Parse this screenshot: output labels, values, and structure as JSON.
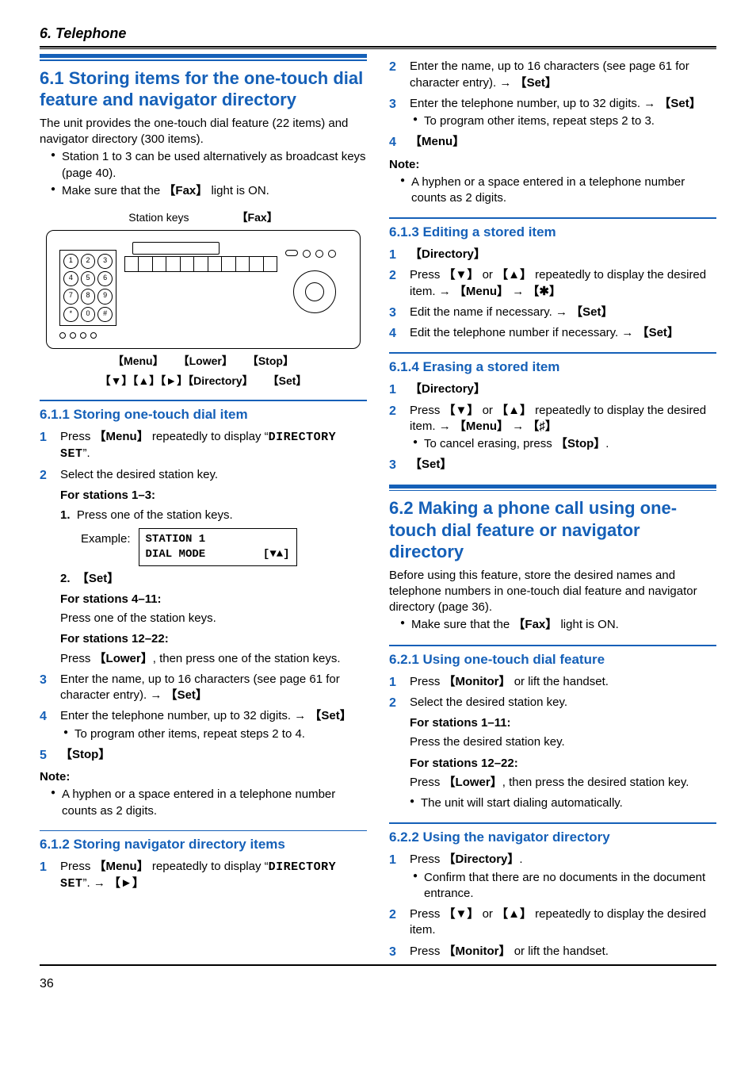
{
  "header": {
    "chapter": "6. Telephone",
    "page_number": "36"
  },
  "figure": {
    "top_labels": {
      "left": "Station keys",
      "right": "【Fax】"
    },
    "bottom_row1": {
      "a": "【Menu】",
      "b": "【Lower】",
      "c": "【Stop】"
    },
    "bottom_row2": {
      "a": "【▼】【▲】【►】【Directory】",
      "b": "【Set】"
    },
    "lcd": {
      "line1": "STATION 1",
      "line2_left": "DIAL MODE",
      "line2_right": "[▼▲]"
    },
    "example_label": "Example:"
  },
  "s61": {
    "title": "6.1 Storing items for the one-touch dial feature and navigator directory",
    "lead": "The unit provides the one-touch dial feature (22 items) and navigator directory (300 items).",
    "b1": "Station 1 to 3 can be used alternatively as broadcast keys (page 40).",
    "b2_pre": "Make sure that the ",
    "b2_btn": "Fax",
    "b2_post": " light is ON."
  },
  "s611": {
    "title": "6.1.1 Storing one-touch dial item",
    "s1_pre": "Press ",
    "s1_btn": "Menu",
    "s1_mid": " repeatedly to display ",
    "s1_q1": "“",
    "s1_mono": "DIRECTORY SET",
    "s1_q2": "”.",
    "s2": "Select the desired station key.",
    "sub13": "For stations 1–3:",
    "sub13_1": "Press one of the station keys.",
    "sub_2_btn": "Set",
    "sub411": "For stations 4–11:",
    "sub411_body": "Press one of the station keys.",
    "sub1222": "For stations 12–22:",
    "sub1222_pre": "Press ",
    "sub1222_btn": "Lower",
    "sub1222_post": ", then press one of the station keys.",
    "s3_pre": "Enter the name, up to 16 characters (see page 61 for character entry). ",
    "s3_btn": "Set",
    "s4_pre": "Enter the telephone number, up to 32 digits. ",
    "s4_btn": "Set",
    "s4_b": "To program other items, repeat steps 2 to 4.",
    "s5_btn": "Stop",
    "note_head": "Note:",
    "note_b": "A hyphen or a space entered in a telephone number counts as 2 digits."
  },
  "s612": {
    "title": "6.1.2 Storing navigator directory items",
    "s1_pre": "Press ",
    "s1_btn": "Menu",
    "s1_mid": " repeatedly to display ",
    "s1_q1": "“",
    "s1_mono": "DIRECTORY SET",
    "s1_q2": "”. ",
    "s1_arrow_btn": "►",
    "s2_pre": "Enter the name, up to 16 characters (see page 61 for character entry). ",
    "s2_btn": "Set",
    "s3_pre": "Enter the telephone number, up to 32 digits. ",
    "s3_btn": "Set",
    "s3_b": "To program other items, repeat steps 2 to 3.",
    "s4_btn": "Menu",
    "note_head": "Note:",
    "note_b": "A hyphen or a space entered in a telephone number counts as 2 digits."
  },
  "s613": {
    "title": "6.1.3 Editing a stored item",
    "s1_btn": "Directory",
    "s2_pre": "Press ",
    "s2_d": "▼",
    "s2_or": " or ",
    "s2_u": "▲",
    "s2_mid": " repeatedly to display the desired item. ",
    "s2_btn1": "Menu",
    "s2_btn2": "✱",
    "s3_pre": "Edit the name if necessary. ",
    "s3_btn": "Set",
    "s4_pre": "Edit the telephone number if necessary. ",
    "s4_btn": "Set"
  },
  "s614": {
    "title": "6.1.4 Erasing a stored item",
    "s1_btn": "Directory",
    "s2_pre": "Press ",
    "s2_d": "▼",
    "s2_or": " or ",
    "s2_u": "▲",
    "s2_mid": " repeatedly to display the desired item. ",
    "s2_btn1": "Menu",
    "s2_btn2": "♯",
    "s2_b_pre": "To cancel erasing, press ",
    "s2_b_btn": "Stop",
    "s3_btn": "Set"
  },
  "s62": {
    "title": "6.2 Making a phone call using one-touch dial feature or navigator directory",
    "lead": "Before using this feature, store the desired names and telephone numbers in one-touch dial feature and navigator directory (page 36).",
    "b1_pre": "Make sure that the ",
    "b1_btn": "Fax",
    "b1_post": " light is ON."
  },
  "s621": {
    "title": "6.2.1 Using one-touch dial feature",
    "s1_pre": "Press ",
    "s1_btn": "Monitor",
    "s1_post": " or lift the handset.",
    "s2": "Select the desired station key.",
    "sub111": "For stations 1–11:",
    "sub111_body": "Press the desired station key.",
    "sub1222": "For stations 12–22:",
    "sub1222_pre": "Press ",
    "sub1222_btn": "Lower",
    "sub1222_post": ", then press the desired station key.",
    "b": "The unit will start dialing automatically."
  },
  "s622": {
    "title": "6.2.2 Using the navigator directory",
    "s1_pre": "Press ",
    "s1_btn": "Directory",
    "s1_b": "Confirm that there are no documents in the document entrance.",
    "s2_pre": "Press ",
    "s2_d": "▼",
    "s2_or": " or ",
    "s2_u": "▲",
    "s2_post": " repeatedly to display the desired item.",
    "s3_pre": "Press ",
    "s3_btn": "Monitor",
    "s3_post": " or lift the handset."
  }
}
